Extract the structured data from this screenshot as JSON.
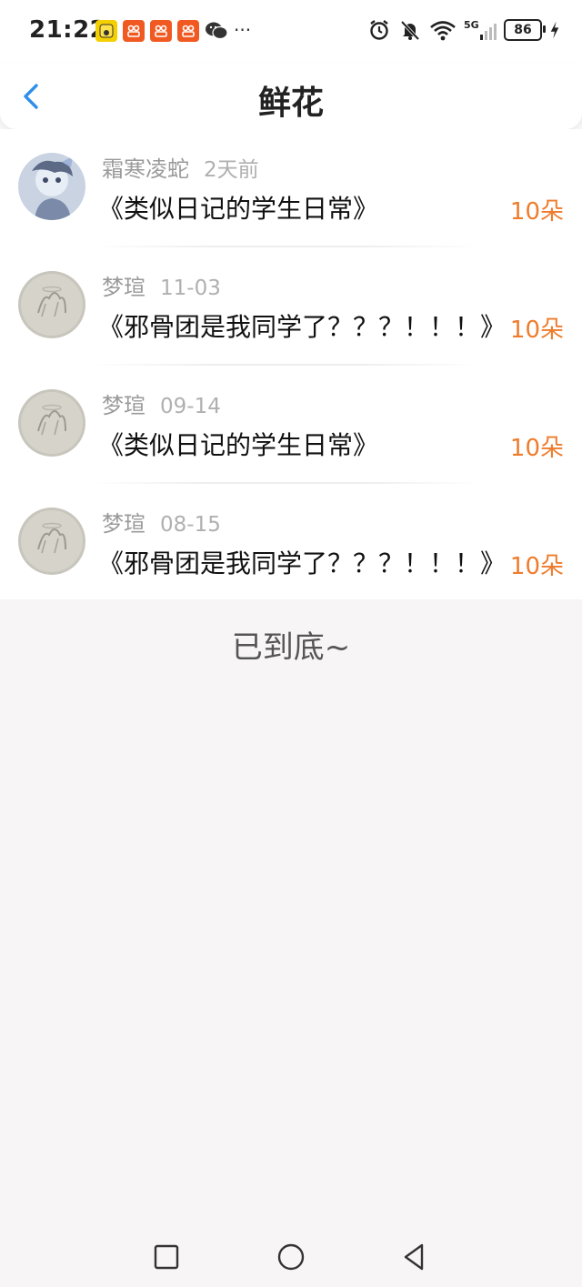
{
  "status_bar": {
    "time": "21:22",
    "battery": "86",
    "notification_icons": [
      "app-badge-icon",
      "app-badge-icon",
      "app-badge-icon",
      "app-badge-icon",
      "wechat-icon"
    ],
    "more": "···"
  },
  "header": {
    "title": "鲜花"
  },
  "items": [
    {
      "user": "霜寒凌蛇",
      "date": "2天前",
      "title": "《类似日记的学生日常》",
      "amount": "10朵"
    },
    {
      "user": "梦瑄",
      "date": "11-03",
      "title": "《邪骨团是我同学了？？？！！！》",
      "amount": "10朵"
    },
    {
      "user": "梦瑄",
      "date": "09-14",
      "title": "《类似日记的学生日常》",
      "amount": "10朵"
    },
    {
      "user": "梦瑄",
      "date": "08-15",
      "title": "《邪骨团是我同学了？？？！！！》",
      "amount": "10朵"
    }
  ],
  "end_text": "已到底~",
  "colors": {
    "accent_blue": "#2f8fe8",
    "amount_orange": "#ee7c2c",
    "background": "#f7f5f6"
  }
}
